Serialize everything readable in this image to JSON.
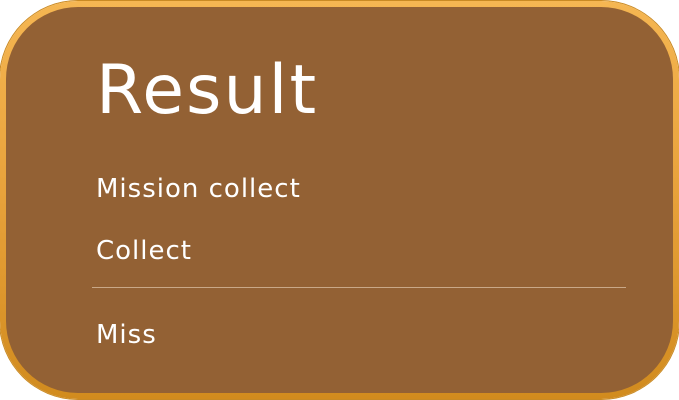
{
  "result_panel": {
    "title": "Result",
    "rows": [
      {
        "label": "Mission collect"
      },
      {
        "label": "Collect"
      },
      {
        "label": "Miss"
      }
    ]
  },
  "colors": {
    "panel_fill": "#936134",
    "border_gold": "#e7a13a",
    "text": "#ffffff"
  }
}
